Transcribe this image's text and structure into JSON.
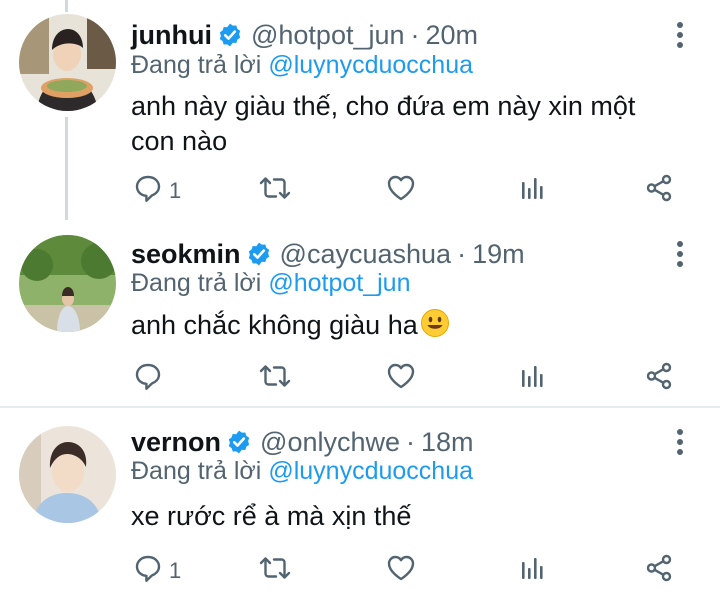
{
  "tweets": [
    {
      "name": "junhui",
      "handle": "@hotpot_jun",
      "time": "20m",
      "reply_prefix": "Đang trả lời",
      "reply_to": "@luynycduocchua",
      "text": "anh này giàu thế, cho đứa em này xin một con nào",
      "reply_count": "1"
    },
    {
      "name": "seokmin",
      "handle": "@caycuashua",
      "time": "19m",
      "reply_prefix": "Đang trả lời",
      "reply_to": "@hotpot_jun",
      "text": "anh chắc không giàu ha",
      "reply_count": ""
    },
    {
      "name": "vernon",
      "handle": "@onlychwe",
      "time": "18m",
      "reply_prefix": "Đang trả lời",
      "reply_to": "@luynycduocchua",
      "text": "xe rước rể à mà xịn thế",
      "reply_count": "1"
    }
  ],
  "separator": "·",
  "colors": {
    "accent": "#1d9bf0",
    "muted": "#536471",
    "text": "#0f1419",
    "thread_line": "#cfd9de"
  },
  "icons": [
    "verified-badge-icon",
    "more-vertical-icon",
    "reply-icon",
    "retweet-icon",
    "like-icon",
    "analytics-icon",
    "share-icon",
    "smiley-emoji"
  ]
}
